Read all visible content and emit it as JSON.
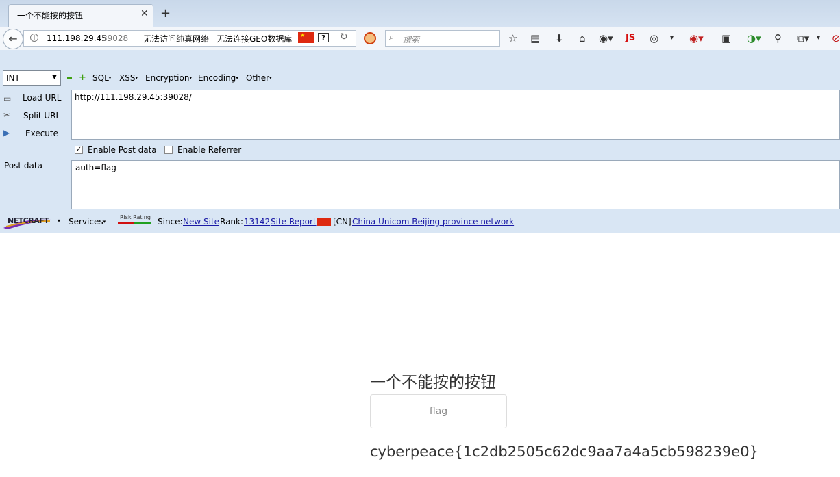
{
  "tab": {
    "title": "一个不能按的按钮",
    "close": "✕",
    "new_tab": "+"
  },
  "navbar": {
    "back": "←",
    "info": "i",
    "url_host": "111.198.29.45:",
    "url_port": "39028",
    "geo_notice_1": "无法访问纯真网络",
    "geo_notice_2": "无法连接GEO数据库",
    "question": "?",
    "reload": "↻",
    "search_icon": "🔍",
    "search_placeholder": "搜索",
    "toolbar_icons": [
      "star-icon",
      "reading-list-icon",
      "download-icon",
      "home-icon",
      "globe-icon",
      "js-icon",
      "palette-icon",
      "stop-icon",
      "image-icon",
      "network-icon",
      "zoom-icon",
      "copy-icon",
      "adblock-icon"
    ],
    "js_label": "JS"
  },
  "hackbar": {
    "select_value": "INT",
    "menus": [
      {
        "label": "SQL"
      },
      {
        "label": "XSS"
      },
      {
        "label": "Encryption"
      },
      {
        "label": "Encoding"
      },
      {
        "label": "Other"
      }
    ],
    "load_url_label": "Load URL",
    "split_url_label": "Split URL",
    "execute_label": "Execute",
    "url_value": "http://111.198.29.45:39028/",
    "enable_post_label": "Enable Post data",
    "enable_post_checked": true,
    "enable_referrer_label": "Enable Referrer",
    "enable_referrer_checked": false,
    "post_data_label": "Post data",
    "post_data_value": "auth=flag"
  },
  "netcraft": {
    "logo_text": "NETCRAFT",
    "services_label": "Services",
    "risk_rating": "Risk Rating",
    "since_label": "Since:",
    "since_value": "New Site",
    "rank_label": "Rank:",
    "rank_value": "13142",
    "site_report": "Site Report",
    "country_code": "[CN]",
    "network": "China Unicom Beijing province network"
  },
  "page": {
    "heading": "一个不能按的按钮",
    "button_label": "flag",
    "flag_output": "cyberpeace{1c2db2505c62dc9aa7a4a5cb598239e0}"
  },
  "colors": {
    "hackbar_bg": "#d9e6f4",
    "link": "#1a1aa6",
    "flag_red": "#de2910"
  }
}
